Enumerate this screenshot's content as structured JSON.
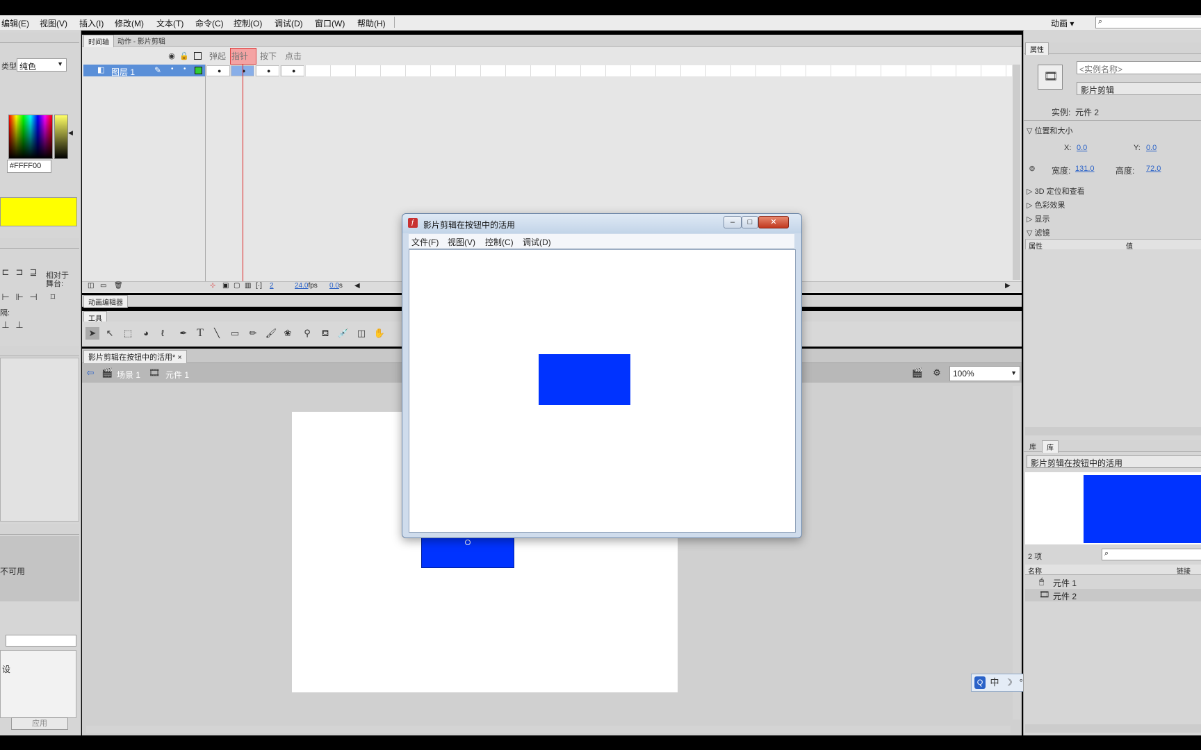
{
  "menu": [
    "编辑(E)",
    "视图(V)",
    "插入(I)",
    "修改(M)",
    "文本(T)",
    "命令(C)",
    "控制(O)",
    "调试(D)",
    "窗口(W)",
    "帮助(H)"
  ],
  "workspace": "动画",
  "search_placeholder": "",
  "left": {
    "type_label": "类型:",
    "type_value": "纯色",
    "hex": "#FFFF00",
    "fill_color": "#FFFF00",
    "align_label": "相对于\n舞台:",
    "spacing_label": "隔:",
    "unavailable": "不可用",
    "preset_row": "设",
    "apply": "应用"
  },
  "timeline": {
    "tabs": [
      "时间轴",
      "动作 - 影片剪辑"
    ],
    "frame_labels": [
      "弹起",
      "指针",
      "按下",
      "点击"
    ],
    "layer_name": "图层 1",
    "current_frame": "2",
    "fps": "24.0",
    "fps_unit": "fps",
    "time": "0.0",
    "time_unit": "s"
  },
  "motion_editor_tab": "动画编辑器",
  "tools_tab": "工具",
  "doc": {
    "tab": "影片剪辑在按钮中的活用*",
    "crumb_scene": "场景 1",
    "crumb_symbol": "元件 1",
    "zoom": "100%"
  },
  "popup": {
    "title": "影片剪辑在按钮中的活用",
    "menus": [
      "文件(F)",
      "视图(V)",
      "控制(C)",
      "调试(D)"
    ],
    "rect_color": "#0033ff"
  },
  "properties": {
    "tab": "属性",
    "instance_name": "<实例名称>",
    "instance_type": "影片剪辑",
    "instance_label": "实例:",
    "instance_value": "元件 2",
    "section_pos": "位置和大小",
    "x_label": "X:",
    "x_value": "0.0",
    "y_label": "Y:",
    "y_value": "0.0",
    "w_label": "宽度:",
    "w_value": "131.0",
    "h_label": "高度:",
    "h_value": "72.0",
    "section_3d": "3D 定位和查看",
    "section_color": "色彩效果",
    "section_display": "显示",
    "section_filter": "滤镜",
    "col_prop": "属性",
    "col_val": "值"
  },
  "library": {
    "tabs": [
      "库",
      "库"
    ],
    "doc": "影片剪辑在按钮中的活用",
    "count": "2 项",
    "col_name": "名称",
    "col_link": "链接",
    "items": [
      "元件 1",
      "元件 2"
    ]
  },
  "ime": [
    "中",
    "☽",
    "°,",
    "⌨",
    "✣",
    "🔧"
  ]
}
